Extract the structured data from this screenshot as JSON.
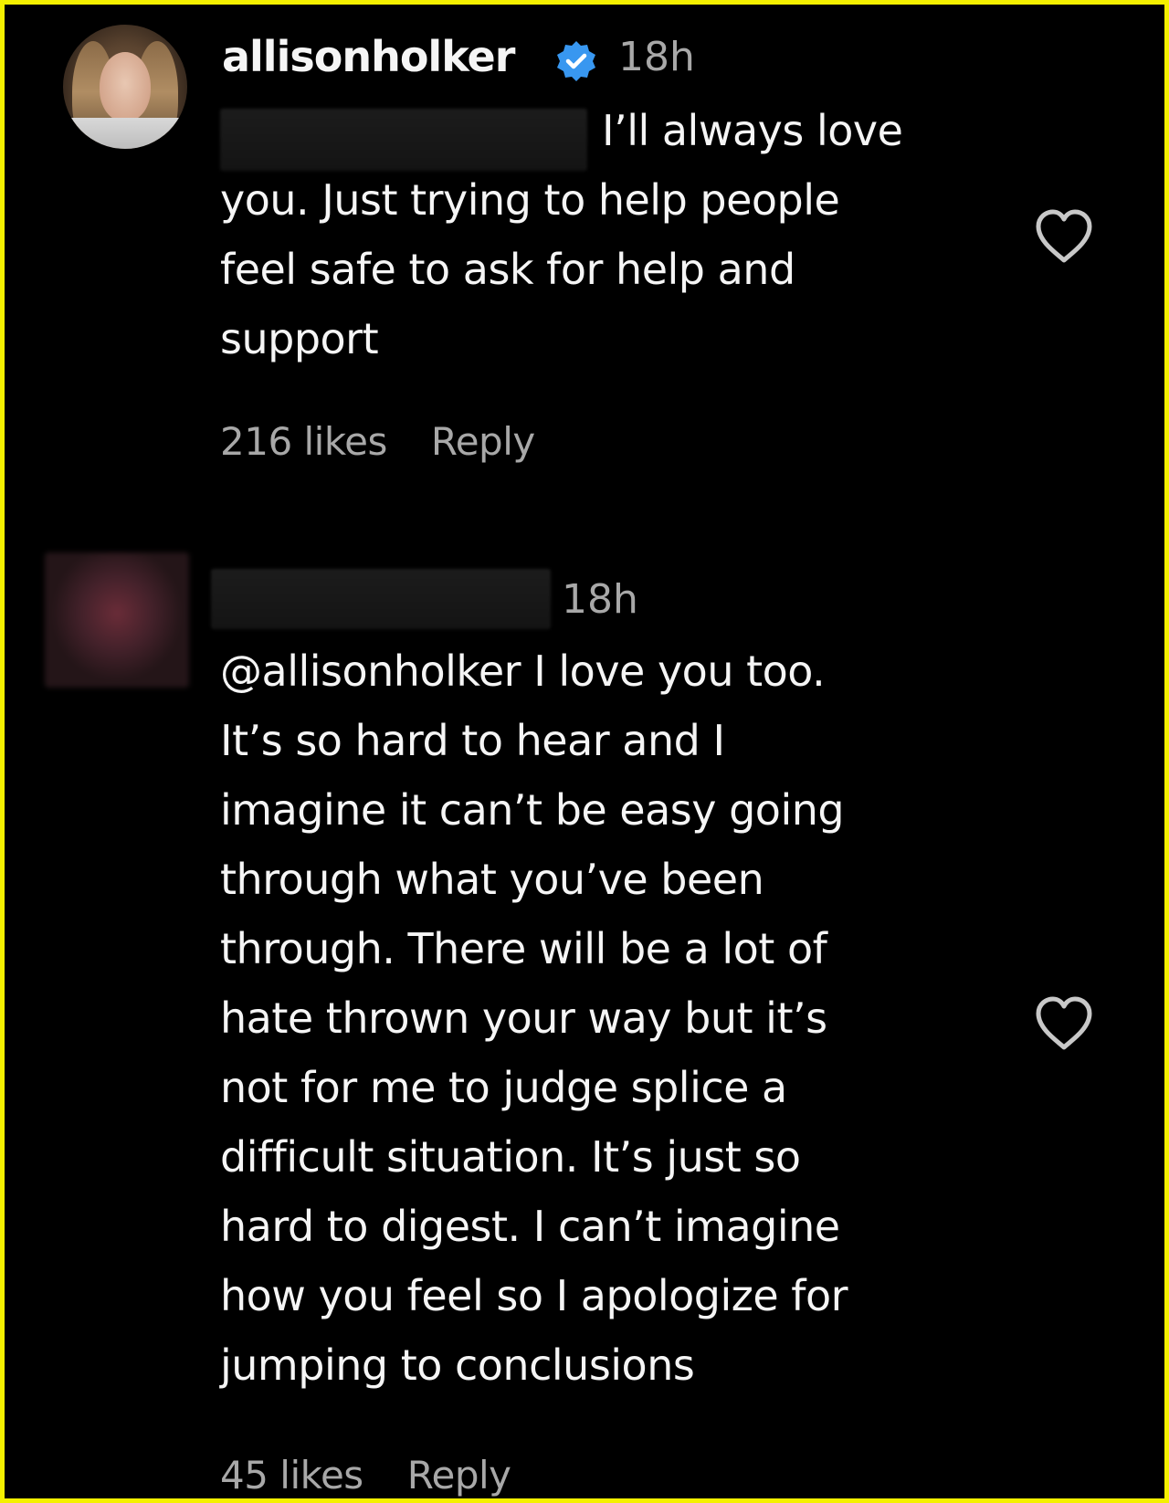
{
  "comments": [
    {
      "username": "allisonholker",
      "verified": true,
      "time": "18h",
      "text_line1": "I’ll always love",
      "text_rest": "you. Just trying to help people\nfeel safe to ask for help and\nsupport",
      "likes": "216 likes",
      "reply_label": "Reply",
      "avatar_icon": "profile-photo",
      "like_icon": "heart-outline-icon"
    },
    {
      "username": "",
      "time": "18h",
      "text": "@allisonholker I love you too.\nIt’s so hard to hear and I\nimagine it can’t be easy going\nthrough what you’ve been\nthrough. There will be a lot of\nhate thrown your way but it’s\nnot for me to judge splice a\ndifficult situation. It’s just so\nhard to digest. I can’t imagine\nhow you feel so I apologize for\njumping to conclusions",
      "likes": "45 likes",
      "reply_label": "Reply",
      "avatar_icon": "blurred-profile-photo",
      "like_icon": "heart-outline-icon"
    }
  ],
  "colors": {
    "background": "#000000",
    "border": "#f4f000",
    "text": "#f5f5f5",
    "muted": "#a8a8a8",
    "verified": "#3897f0"
  }
}
